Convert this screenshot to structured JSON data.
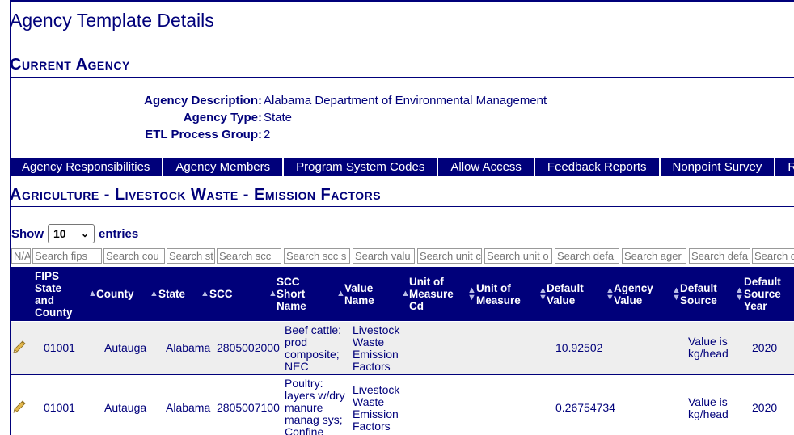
{
  "page_title": "Agency Template Details",
  "current_agency": {
    "heading": "Current Agency",
    "fields": [
      {
        "label": "Agency Description:",
        "value": "Alabama Department of Environmental Management"
      },
      {
        "label": "Agency Type:",
        "value": "State"
      },
      {
        "label": "ETL Process Group:",
        "value": "2"
      }
    ]
  },
  "tabs": [
    "Agency Responsibilities",
    "Agency Members",
    "Program System Codes",
    "Allow Access",
    "Feedback Reports",
    "Nonpoint Survey",
    "R"
  ],
  "section_heading": "Agriculture - Livestock Waste - Emission Factors",
  "show_entries": {
    "prefix": "Show",
    "selected": "10",
    "suffix": "entries"
  },
  "filters": [
    "N/A",
    "Search fips",
    "Search cou",
    "Search st",
    "Search scc",
    "Search scc s",
    "Search valu",
    "Search unit c",
    "Search unit o",
    "Search defa",
    "Search ager",
    "Search defa",
    "Search d"
  ],
  "columns": [
    {
      "lines": [
        "FIPS",
        "State",
        "and",
        "County"
      ]
    },
    {
      "lines": [
        "County"
      ]
    },
    {
      "lines": [
        "State"
      ]
    },
    {
      "lines": [
        "SCC"
      ]
    },
    {
      "lines": [
        "SCC",
        "Short",
        "Name"
      ]
    },
    {
      "lines": [
        "Value",
        "Name"
      ]
    },
    {
      "lines": [
        "Unit of",
        "Measure",
        "Cd"
      ]
    },
    {
      "lines": [
        "Unit of",
        "Measure"
      ]
    },
    {
      "lines": [
        "Default",
        "Value"
      ]
    },
    {
      "lines": [
        "Agency",
        "Value"
      ]
    },
    {
      "lines": [
        "Default",
        "Source"
      ]
    },
    {
      "lines": [
        "Default",
        "Source",
        "Year"
      ]
    }
  ],
  "rows": [
    {
      "fips": "01001",
      "county": "Autauga",
      "state": "Alabama",
      "scc": "2805002000",
      "scc_short_name": [
        "Beef cattle:",
        "prod",
        "composite;",
        "NEC"
      ],
      "value_name": [
        "Livestock",
        "Waste",
        "Emission",
        "Factors"
      ],
      "default_value": "10.92502",
      "default_source": [
        "Value is",
        "kg/head"
      ],
      "default_source_year": "2020"
    },
    {
      "fips": "01001",
      "county": "Autauga",
      "state": "Alabama",
      "scc": "2805007100",
      "scc_short_name": [
        "Poultry:",
        "layers w/dry",
        "manure",
        "manag sys;",
        "Confine"
      ],
      "value_name": [
        "Livestock",
        "Waste",
        "Emission",
        "Factors"
      ],
      "default_value": "0.26754734",
      "default_source": [
        "Value is",
        "kg/head"
      ],
      "default_source_year": "2020"
    }
  ],
  "colors": {
    "navy": "#00007a",
    "row_alt": "#eeeeee",
    "sort_icon": "#b9bde6"
  }
}
